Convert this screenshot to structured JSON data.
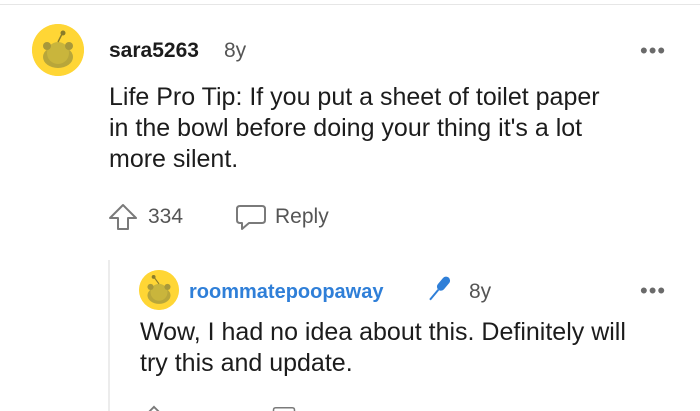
{
  "comment": {
    "username": "sara5263",
    "age": "8y",
    "more_label": "•••",
    "body": [
      "Life Pro Tip: If you put a sheet of toilet paper",
      "in the bowl before doing your thing it's a lot",
      "more silent."
    ],
    "upvotes": "334",
    "reply_label": "Reply",
    "avatar_color": "#ffd635"
  },
  "reply": {
    "username": "roommatepoopaway",
    "age": "8y",
    "more_label": "•••",
    "body": [
      "Wow, I had no idea about this. Definitely will",
      "try this and update."
    ],
    "username_color": "#2f7fd8",
    "op_icon": "microphone-icon"
  }
}
